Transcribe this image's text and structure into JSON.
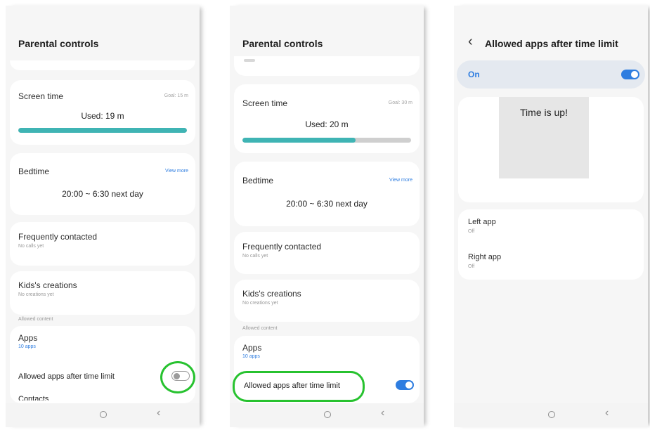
{
  "colors": {
    "accent": "#2e7de0",
    "highlight": "#27c22f",
    "progress": "#3fb4b4"
  },
  "icons": {
    "back": "chevron-left-icon",
    "home": "home-circle-icon"
  },
  "nav": {
    "back_glyph": "‹"
  },
  "panel1": {
    "title": "Parental controls",
    "screen_time": {
      "label": "Screen time",
      "goal": "Goal: 15 m",
      "used": "Used: 19 m",
      "progress": 1.0
    },
    "bedtime": {
      "label": "Bedtime",
      "view_more": "View more",
      "range": "20:00 ~ 6:30 next day"
    },
    "frequently_contacted": {
      "label": "Frequently contacted",
      "sub": "No calls yet"
    },
    "kids_creations": {
      "label": "Kids's creations",
      "sub": "No creations yet"
    },
    "allowed_content_header": "Allowed content",
    "apps": {
      "label": "Apps",
      "count": "10 apps"
    },
    "allowed_apps_after_limit": {
      "label": "Allowed apps after time limit",
      "toggle": "off"
    },
    "contacts_partial": "Contacts"
  },
  "panel2": {
    "title": "Parental controls",
    "screen_time": {
      "label": "Screen time",
      "goal": "Goal: 30 m",
      "used": "Used: 20 m",
      "progress": 0.67
    },
    "bedtime": {
      "label": "Bedtime",
      "view_more": "View more",
      "range": "20:00 ~ 6:30 next day"
    },
    "frequently_contacted": {
      "label": "Frequently contacted",
      "sub": "No calls yet"
    },
    "kids_creations": {
      "label": "Kids's creations",
      "sub": "No creations yet"
    },
    "allowed_content_header": "Allowed content",
    "apps": {
      "label": "Apps",
      "count": "10 apps"
    },
    "allowed_apps_after_limit": {
      "label": "Allowed apps after time limit",
      "toggle": "on"
    }
  },
  "panel3": {
    "title": "Allowed apps after time limit",
    "master": {
      "label": "On",
      "toggle": "on"
    },
    "preview_text": "Time is up!",
    "left_app": {
      "label": "Left app",
      "sub": "Off"
    },
    "right_app": {
      "label": "Right app",
      "sub": "Off"
    }
  }
}
